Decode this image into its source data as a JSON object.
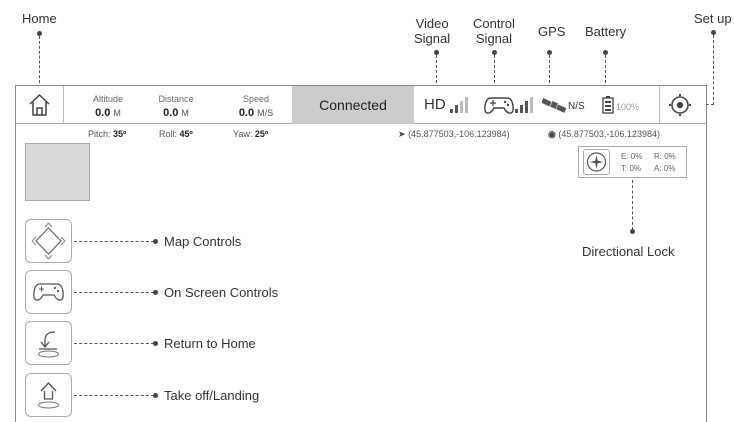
{
  "annotations": {
    "home": "Home",
    "video_signal": "Video\nSignal",
    "control_signal": "Control\nSignal",
    "gps": "GPS",
    "battery": "Battery",
    "setup": "Set up",
    "directional_lock": "Directional Lock"
  },
  "topbar": {
    "altitude": {
      "label": "Altitude",
      "value": "0.0",
      "unit": "M"
    },
    "distance": {
      "label": "Distance",
      "value": "0.0",
      "unit": "M"
    },
    "speed": {
      "label": "Speed",
      "value": "0.0",
      "unit": "M/S"
    },
    "status": "Connected",
    "video_hd": "HD",
    "gps_status": "N/S",
    "battery_pct": "100%"
  },
  "attitude": {
    "pitch_label": "Pitch:",
    "pitch": "35º",
    "roll_label": "Roll:",
    "roll": "45º",
    "yaw_label": "Yaw:",
    "yaw": "25º"
  },
  "coords": {
    "drone": "(45.877503,-106.123984)",
    "controller": "(45.877503,-106.123984)"
  },
  "lock_stats": {
    "e": "E: 0%",
    "r": "R: 0%",
    "t": "T: 0%",
    "a": "A: 0%"
  },
  "side_controls": [
    {
      "label": "Map Controls"
    },
    {
      "label": "On Screen Controls"
    },
    {
      "label": "Return to Home"
    },
    {
      "label": "Take off/Landing"
    }
  ],
  "colors": {
    "status_bg": "#cccccc",
    "border": "#aaaaaa",
    "text": "#333333"
  }
}
